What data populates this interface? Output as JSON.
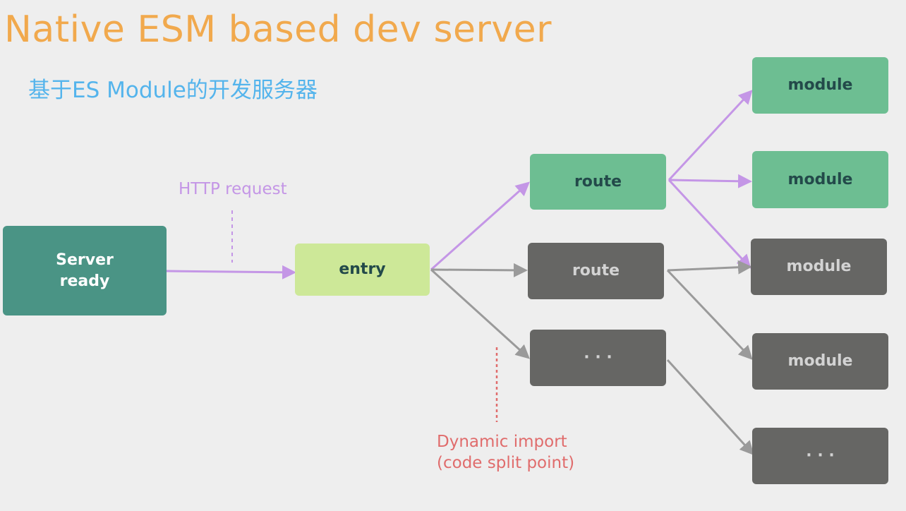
{
  "title": "Native ESM based dev server",
  "subtitle": "基于ES Module的开发服务器",
  "colors": {
    "title": "#f1a94d",
    "subtitle": "#54b4ec",
    "server_node": "#4a9485",
    "entry_node": "#cde898",
    "active_node": "#6dbe92",
    "inactive_node": "#666664",
    "active_edge": "#c496e6",
    "inactive_edge": "#9a9a9a",
    "dynamic_import_annotation": "#e06c6c"
  },
  "nodes": {
    "server": {
      "line1": "Server",
      "line2": "ready"
    },
    "entry": {
      "label": "entry"
    },
    "route_active": {
      "label": "route"
    },
    "route_inactive": {
      "label": "route"
    },
    "route_more": {
      "label": "· · ·"
    },
    "module_1": {
      "label": "module"
    },
    "module_2": {
      "label": "module"
    },
    "module_3": {
      "label": "module"
    },
    "module_4": {
      "label": "module"
    },
    "module_more": {
      "label": "· · ·"
    }
  },
  "annotations": {
    "http_request": "HTTP request",
    "dynamic_import_line1": "Dynamic import",
    "dynamic_import_line2": "(code split point)"
  },
  "edges": [
    {
      "from": "server",
      "to": "entry",
      "state": "active"
    },
    {
      "from": "entry",
      "to": "route_active",
      "state": "active"
    },
    {
      "from": "entry",
      "to": "route_inactive",
      "state": "inactive"
    },
    {
      "from": "entry",
      "to": "route_more",
      "state": "inactive"
    },
    {
      "from": "route_active",
      "to": "module_1",
      "state": "active"
    },
    {
      "from": "route_active",
      "to": "module_2",
      "state": "active"
    },
    {
      "from": "route_active",
      "to": "module_3",
      "state": "active"
    },
    {
      "from": "route_inactive",
      "to": "module_3",
      "state": "inactive"
    },
    {
      "from": "route_inactive",
      "to": "module_4",
      "state": "inactive"
    },
    {
      "from": "route_more",
      "to": "module_more",
      "state": "inactive"
    }
  ]
}
